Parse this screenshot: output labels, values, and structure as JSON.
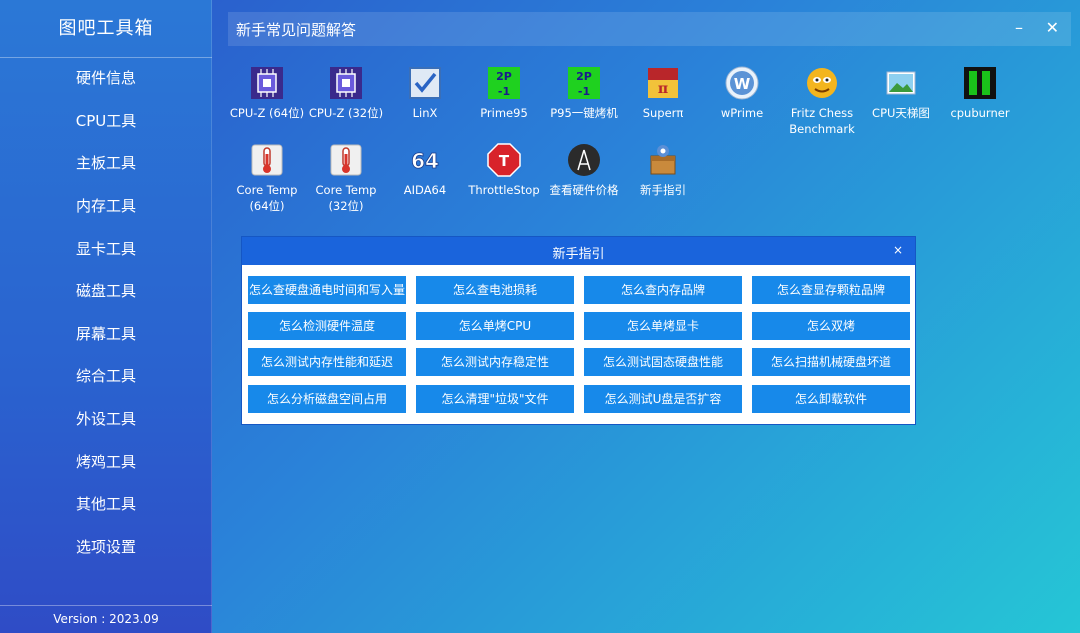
{
  "app_title": "图吧工具箱",
  "sidebar": {
    "items": [
      {
        "label": "硬件信息"
      },
      {
        "label": "CPU工具"
      },
      {
        "label": "主板工具"
      },
      {
        "label": "内存工具"
      },
      {
        "label": "显卡工具"
      },
      {
        "label": "磁盘工具"
      },
      {
        "label": "屏幕工具"
      },
      {
        "label": "综合工具"
      },
      {
        "label": "外设工具"
      },
      {
        "label": "烤鸡工具"
      },
      {
        "label": "其他工具"
      },
      {
        "label": "选项设置"
      }
    ],
    "version": "Version : 2023.09"
  },
  "topbar": {
    "title": "新手常见问题解答",
    "minimize": "–",
    "close": "✕"
  },
  "tools": [
    {
      "label": "CPU-Z (64位)",
      "icon": "cpu-z-icon"
    },
    {
      "label": "CPU-Z (32位)",
      "icon": "cpu-z-icon"
    },
    {
      "label": "LinX",
      "icon": "linx-icon"
    },
    {
      "label": "Prime95",
      "icon": "prime95-icon"
    },
    {
      "label": "P95一键烤机",
      "icon": "prime95-icon"
    },
    {
      "label": "Superπ",
      "icon": "superpi-icon"
    },
    {
      "label": "wPrime",
      "icon": "wprime-icon"
    },
    {
      "label": "Fritz Chess\nBenchmark",
      "icon": "fritz-chess-icon"
    },
    {
      "label": "CPU天梯图",
      "icon": "picture-icon"
    },
    {
      "label": "cpuburner",
      "icon": "cpuburner-icon"
    },
    {
      "label": "Core Temp\n(64位)",
      "icon": "thermometer-icon"
    },
    {
      "label": "Core Temp\n(32位)",
      "icon": "thermometer-icon"
    },
    {
      "label": "AIDA64",
      "icon": "aida64-icon"
    },
    {
      "label": "ThrottleStop",
      "icon": "stop-sign-icon"
    },
    {
      "label": "查看硬件价格",
      "icon": "price-icon"
    },
    {
      "label": "新手指引",
      "icon": "guide-icon"
    }
  ],
  "dialog": {
    "title": "新手指引",
    "close": "×",
    "buttons": [
      "怎么查硬盘通电时间和写入量",
      "怎么查电池损耗",
      "怎么查内存品牌",
      "怎么查显存颗粒品牌",
      "怎么检测硬件温度",
      "怎么单烤CPU",
      "怎么单烤显卡",
      "怎么双烤",
      "怎么测试内存性能和延迟",
      "怎么测试内存稳定性",
      "怎么测试固态硬盘性能",
      "怎么扫描机械硬盘坏道",
      "怎么分析磁盘空间占用",
      "怎么清理\"垃圾\"文件",
      "怎么测试U盘是否扩容",
      "怎么卸载软件"
    ]
  },
  "colors": {
    "accent": "#1a64dc",
    "button": "#1789ea",
    "sidebar": "#2a62cf"
  }
}
